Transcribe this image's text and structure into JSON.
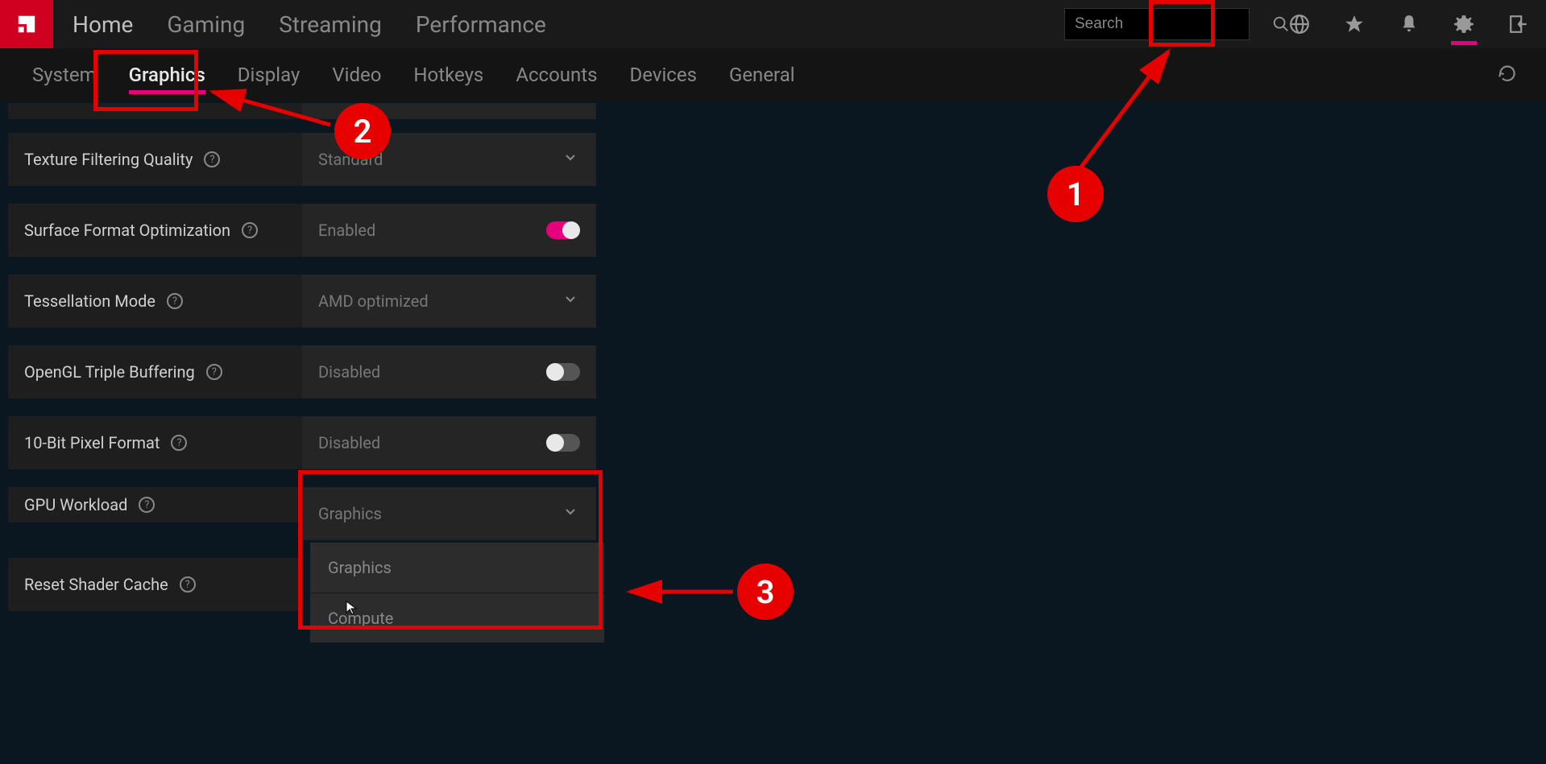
{
  "colors": {
    "accent": "#e6007e",
    "brand": "#d00020",
    "anno": "#e60000"
  },
  "topnav": {
    "items": [
      "Home",
      "Gaming",
      "Streaming",
      "Performance"
    ]
  },
  "search": {
    "placeholder": "Search"
  },
  "subtabs": {
    "items": [
      "System",
      "Graphics",
      "Display",
      "Video",
      "Hotkeys",
      "Accounts",
      "Devices",
      "General"
    ],
    "active_index": 1
  },
  "settings": [
    {
      "label": "Texture Filtering Quality",
      "value": "Standard",
      "type": "select"
    },
    {
      "label": "Surface Format Optimization",
      "value": "Enabled",
      "type": "toggle",
      "on": true
    },
    {
      "label": "Tessellation Mode",
      "value": "AMD optimized",
      "type": "select"
    },
    {
      "label": "OpenGL Triple Buffering",
      "value": "Disabled",
      "type": "toggle",
      "on": false
    },
    {
      "label": "10-Bit Pixel Format",
      "value": "Disabled",
      "type": "toggle",
      "on": false
    },
    {
      "label": "GPU Workload",
      "value": "Graphics",
      "type": "select",
      "open": true,
      "options": [
        "Graphics",
        "Compute"
      ]
    },
    {
      "label": "Reset Shader Cache",
      "value": "",
      "type": "action"
    }
  ],
  "annotations": {
    "nums": {
      "one": "1",
      "two": "2",
      "three": "3"
    }
  }
}
